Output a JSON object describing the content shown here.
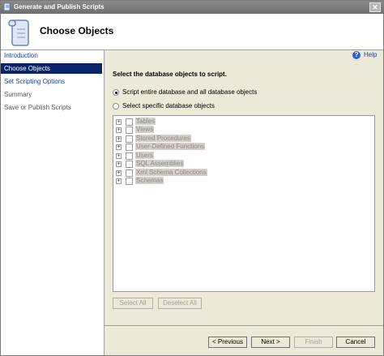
{
  "window": {
    "title": "Generate and Publish Scripts",
    "close_glyph": "✕"
  },
  "header": {
    "title": "Choose Objects"
  },
  "sidebar": {
    "items": [
      {
        "label": "Introduction",
        "state": "link"
      },
      {
        "label": "Choose Objects",
        "state": "selected"
      },
      {
        "label": "Set Scripting Options",
        "state": "link"
      },
      {
        "label": "Summary",
        "state": "disabled"
      },
      {
        "label": "Save or Publish Scripts",
        "state": "disabled"
      }
    ]
  },
  "help": {
    "label": "Help",
    "glyph": "?"
  },
  "main": {
    "instruction": "Select the database objects to script.",
    "radio_options": [
      {
        "label": "Script entire database and all database objects",
        "checked": true
      },
      {
        "label": "Select specific database objects",
        "checked": false
      }
    ],
    "tree_items": [
      "Tables",
      "Views",
      "Stored Procedures",
      "User-Defined Functions",
      "Users",
      "SQL Assemblies",
      "Xml Schema Collections",
      "Schemas"
    ],
    "expander_glyph": "+",
    "select_all_label": "Select All",
    "deselect_all_label": "Deselect All"
  },
  "footer": {
    "previous_label": "< Previous",
    "next_label": "Next >",
    "finish_label": "Finish",
    "cancel_label": "Cancel"
  },
  "colors": {
    "selection": "#0a246a",
    "link": "#1a44a4",
    "chrome": "#ece9d8"
  }
}
